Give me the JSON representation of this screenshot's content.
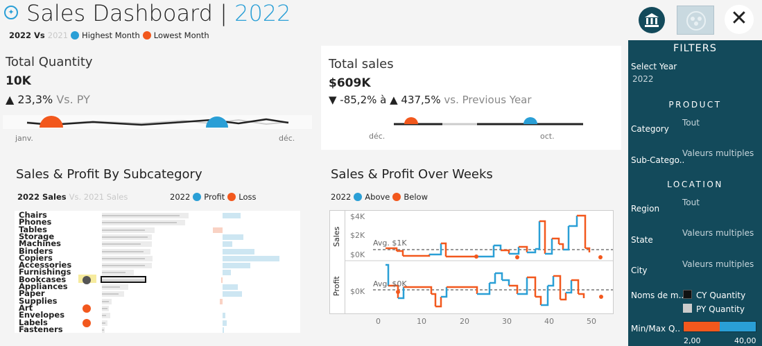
{
  "header": {
    "title_prefix": "Sales Dashboard | ",
    "title_year": "2022",
    "legend": {
      "current": "2022",
      "vs": "Vs",
      "previous": "2021",
      "highest": "Highest Month",
      "lowest": "Lowest Month"
    }
  },
  "kpi_quantity": {
    "title": "Total Quantity",
    "value": "10K",
    "change": "▲ 23,3%",
    "vs": "Vs. PY",
    "axis_start": "janv.",
    "axis_end": "déc."
  },
  "kpi_sales": {
    "title": "Total sales",
    "value": "$609K",
    "change": "▼ -85,2% à ▲ 437,5%",
    "vs": "vs. Previous Year",
    "axis_start": "déc.",
    "axis_end": "oct."
  },
  "subcategory": {
    "title": "Sales & Profit By Subcategory",
    "legend_current": "2022 Sales",
    "legend_previous": "Vs. 2021 Sales",
    "legend_year": "2022",
    "legend_profit": "Profit",
    "legend_loss": "Loss",
    "items": [
      "Chairs",
      "Phones",
      "Tables",
      "Storage",
      "Machines",
      "Binders",
      "Copiers",
      "Accessories",
      "Furnishings",
      "Bookcases",
      "Appliances",
      "Paper",
      "Supplies",
      "Art",
      "Envelopes",
      "Labels",
      "Fasteners"
    ]
  },
  "weeks": {
    "title": "Sales & Profit Over Weeks",
    "legend_year": "2022",
    "legend_above": "Above",
    "legend_below": "Below",
    "sales_axis": "Sales",
    "profit_axis": "Profit",
    "sales_ticks": [
      "$4K",
      "$2K",
      "$0K"
    ],
    "profit_ticks": [
      "$0K"
    ],
    "avg_sales": "Avg. $1K",
    "avg_profit": "Avg. $0K",
    "x_ticks": [
      "0",
      "10",
      "20",
      "30",
      "40",
      "50"
    ]
  },
  "filters": {
    "title": "FILTERS",
    "select_year_label": "Select Year",
    "select_year_value": "2022",
    "product_header": "PRODUCT",
    "category_label": "Category",
    "category_value": "Tout",
    "subcategory_label": "Sub-Catego..",
    "subcategory_value": "Valeurs multiples",
    "location_header": "LOCATION",
    "region_label": "Region",
    "region_value": "Tout",
    "state_label": "State",
    "state_value": "Valeurs multiples",
    "city_label": "City",
    "city_value": "Valeurs multiples",
    "names_label": "Noms de m..",
    "cy_qty": "CY Quantity",
    "py_qty": "PY Quantity",
    "minmax_label": "Min/Max Q..",
    "minmax_min": "2,00",
    "minmax_max": "40,00"
  },
  "colors": {
    "accent_blue": "#2a9fd6",
    "accent_orange": "#f2581d",
    "panel": "#134a5b"
  }
}
